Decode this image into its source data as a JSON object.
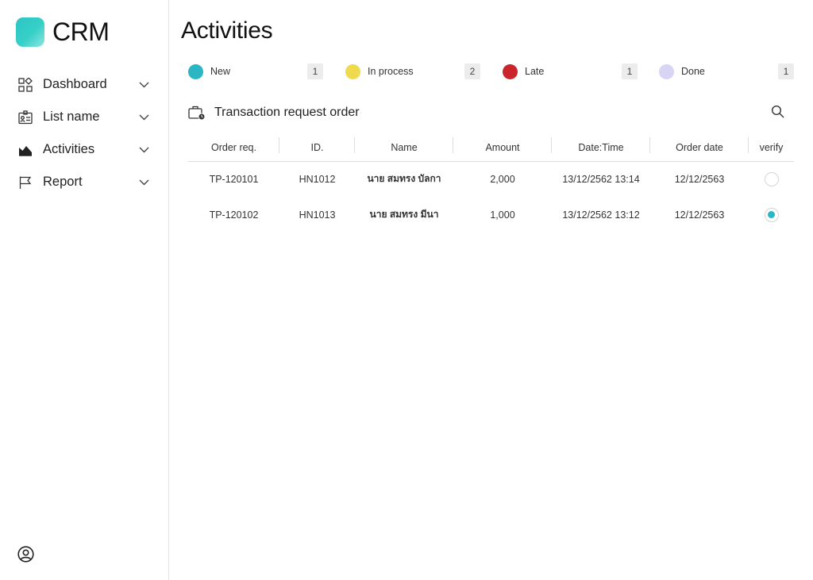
{
  "app": {
    "title": "CRM"
  },
  "sidebar": {
    "items": [
      {
        "label": "Dashboard",
        "icon": "dashboard-icon"
      },
      {
        "label": "List name",
        "icon": "contact-card-icon"
      },
      {
        "label": "Activities",
        "icon": "chart-area-icon"
      },
      {
        "label": "Report",
        "icon": "flag-icon"
      }
    ]
  },
  "page": {
    "title": "Activities"
  },
  "statuses": [
    {
      "label": "New",
      "count": "1",
      "color": "#2bb6c4"
    },
    {
      "label": "In process",
      "count": "2",
      "color": "#efd94c"
    },
    {
      "label": "Late",
      "count": "1",
      "color": "#c9252b"
    },
    {
      "label": "Done",
      "count": "1",
      "color": "#d7d4f4"
    }
  ],
  "section": {
    "title": "Transaction request order"
  },
  "table": {
    "headers": [
      "Order req.",
      "ID.",
      "Name",
      "Amount",
      "Date:Time",
      "Order date",
      "verify"
    ],
    "rows": [
      {
        "order_req": "TP-120101",
        "id": "HN1012",
        "name": "นาย สมทรง บัลกา",
        "amount": "2,000",
        "datetime": "13/12/2562 13:14",
        "order_date": "12/12/2563",
        "verified": false
      },
      {
        "order_req": "TP-120102",
        "id": "HN1013",
        "name": "นาย สมทรง มีนา",
        "amount": "1,000",
        "datetime": "13/12/2562 13:12",
        "order_date": "12/12/2563",
        "verified": true
      }
    ]
  },
  "colors": {
    "accent": "#2ec4c4",
    "radio_selected": "#26b8c4"
  }
}
